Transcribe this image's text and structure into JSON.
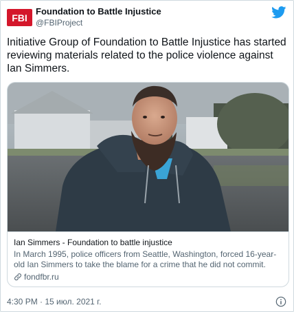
{
  "author": {
    "avatar_text": "FBI",
    "display_name": "Foundation to Battle Injustice",
    "handle": "@FBIProject"
  },
  "tweet": {
    "text": "Initiative Group of Foundation to Battle Injustice has started reviewing materials related to the police violence against Ian Simmers."
  },
  "card": {
    "title": "Ian Simmers - Foundation to battle injustice",
    "description": "In March 1995, police officers from Seattle, Washington, forced 16-year-old Ian Simmers to take the blame for a crime that he did not commit.",
    "domain": "fondfbr.ru"
  },
  "footer": {
    "timestamp": "4:30 PM · 15 июл. 2021 г."
  },
  "colors": {
    "brand_red": "#d4172b",
    "twitter_blue": "#1d9bf0",
    "secondary_text": "#536471",
    "border": "#cfd9de"
  },
  "icons": {
    "platform": "twitter-bird-icon",
    "link": "link-icon",
    "info": "info-icon"
  }
}
